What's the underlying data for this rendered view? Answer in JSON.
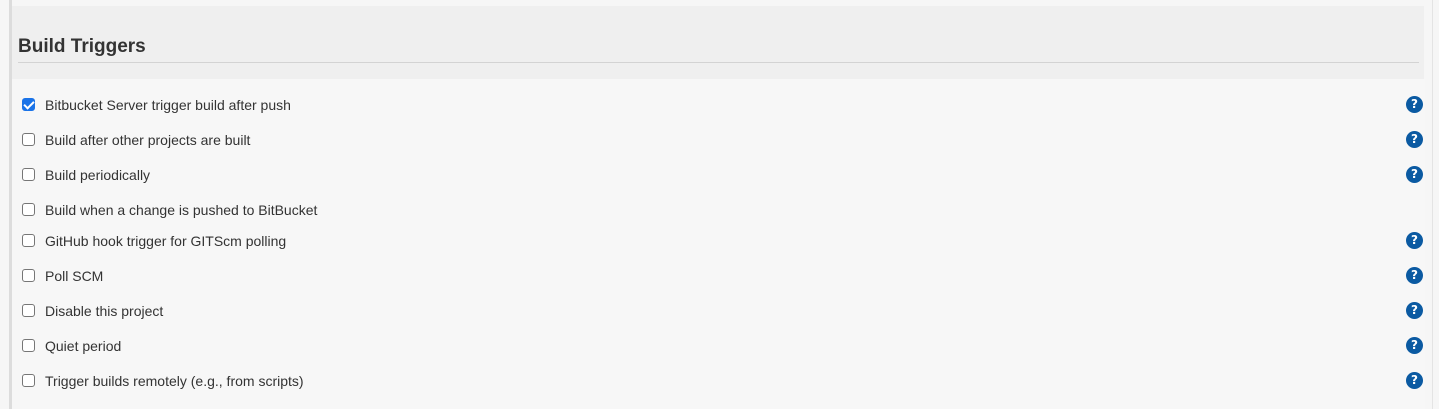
{
  "section": {
    "title": "Build Triggers"
  },
  "help_glyph": "?",
  "colors": {
    "checkbox_checked": "#1a73e8",
    "help_icon": "#0b5aa2",
    "background": "#f6f6f6",
    "header_background": "#efefef"
  },
  "triggers": [
    {
      "label": "Bitbucket Server trigger build after push",
      "checked": true,
      "has_help": true
    },
    {
      "label": "Build after other projects are built",
      "checked": false,
      "has_help": true
    },
    {
      "label": "Build periodically",
      "checked": false,
      "has_help": true
    },
    {
      "label": "Build when a change is pushed to BitBucket",
      "checked": false,
      "has_help": false
    },
    {
      "label": "GitHub hook trigger for GITScm polling",
      "checked": false,
      "has_help": true
    },
    {
      "label": "Poll SCM",
      "checked": false,
      "has_help": true
    },
    {
      "label": "Disable this project",
      "checked": false,
      "has_help": true
    },
    {
      "label": "Quiet period",
      "checked": false,
      "has_help": true
    },
    {
      "label": "Trigger builds remotely (e.g., from scripts)",
      "checked": false,
      "has_help": true
    }
  ]
}
